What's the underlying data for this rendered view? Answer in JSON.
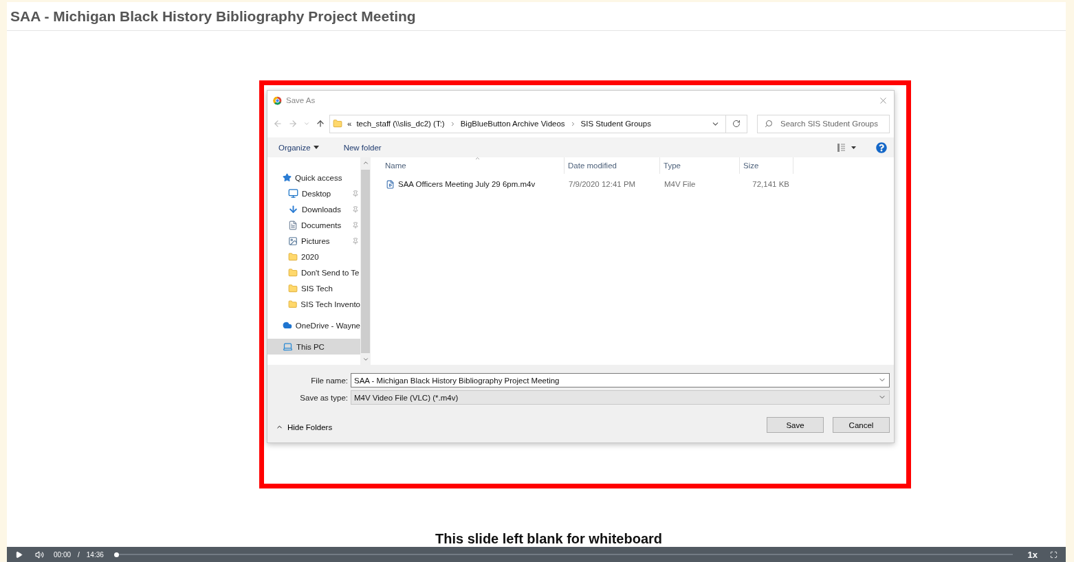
{
  "page": {
    "title": "SAA - Michigan Black History Bibliography Project Meeting"
  },
  "dialog": {
    "title": "Save As",
    "address": {
      "overflow": "«",
      "crumbs": [
        "tech_staff (\\\\slis_dc2) (T:)",
        "BigBlueButton Archive Videos",
        "SIS Student Groups"
      ]
    },
    "search": {
      "placeholder": "Search SIS Student Groups"
    },
    "commands": [
      {
        "label": "Organize",
        "kind": "menu"
      },
      {
        "label": "New folder",
        "kind": "plain"
      }
    ],
    "nav": [
      {
        "label": "Quick access",
        "kind": "star",
        "pinned": false,
        "selected": false,
        "children": [
          {
            "label": "Desktop",
            "kind": "desktop",
            "pinned": true,
            "selected": false
          },
          {
            "label": "Downloads",
            "kind": "download",
            "pinned": true,
            "selected": false
          },
          {
            "label": "Documents",
            "kind": "documents",
            "pinned": true,
            "selected": false
          },
          {
            "label": "Pictures",
            "kind": "pictures",
            "pinned": true,
            "selected": false
          },
          {
            "label": "2020",
            "kind": "folder",
            "pinned": false,
            "selected": false
          },
          {
            "label": "Don't Send to Te",
            "kind": "folder",
            "pinned": false,
            "selected": false
          },
          {
            "label": "SIS Tech",
            "kind": "folder",
            "pinned": false,
            "selected": false
          },
          {
            "label": "SIS Tech Invento",
            "kind": "folder",
            "pinned": false,
            "selected": false
          }
        ]
      },
      {
        "label": "OneDrive - Wayne",
        "kind": "cloud",
        "pinned": false,
        "selected": false
      },
      {
        "label": "This PC",
        "kind": "pc",
        "pinned": false,
        "selected": true
      }
    ],
    "columns": [
      {
        "label": "Name",
        "sorted": true
      },
      {
        "label": "Date modified",
        "sorted": false
      },
      {
        "label": "Type",
        "sorted": false
      },
      {
        "label": "Size",
        "sorted": false
      }
    ],
    "files": [
      {
        "name": "SAA Officers Meeting July 29 6pm.m4v",
        "date": "7/9/2020 12:41 PM",
        "type": "M4V File",
        "size": "72,141 KB",
        "selected": false
      }
    ],
    "file_name": {
      "label": "File name:",
      "value": "SAA - Michigan Black History Bibliography Project Meeting"
    },
    "save_type": {
      "label": "Save as type:",
      "value": "M4V Video File (VLC) (*.m4v)"
    },
    "hide_folders": "Hide Folders",
    "buttons": [
      "Save",
      "Cancel"
    ]
  },
  "slide_caption": "This slide left blank for whiteboard",
  "player": {
    "time": "00:00",
    "separator": "/",
    "duration": "14:36",
    "speed": "1x",
    "progress": {
      "level": 0
    }
  }
}
